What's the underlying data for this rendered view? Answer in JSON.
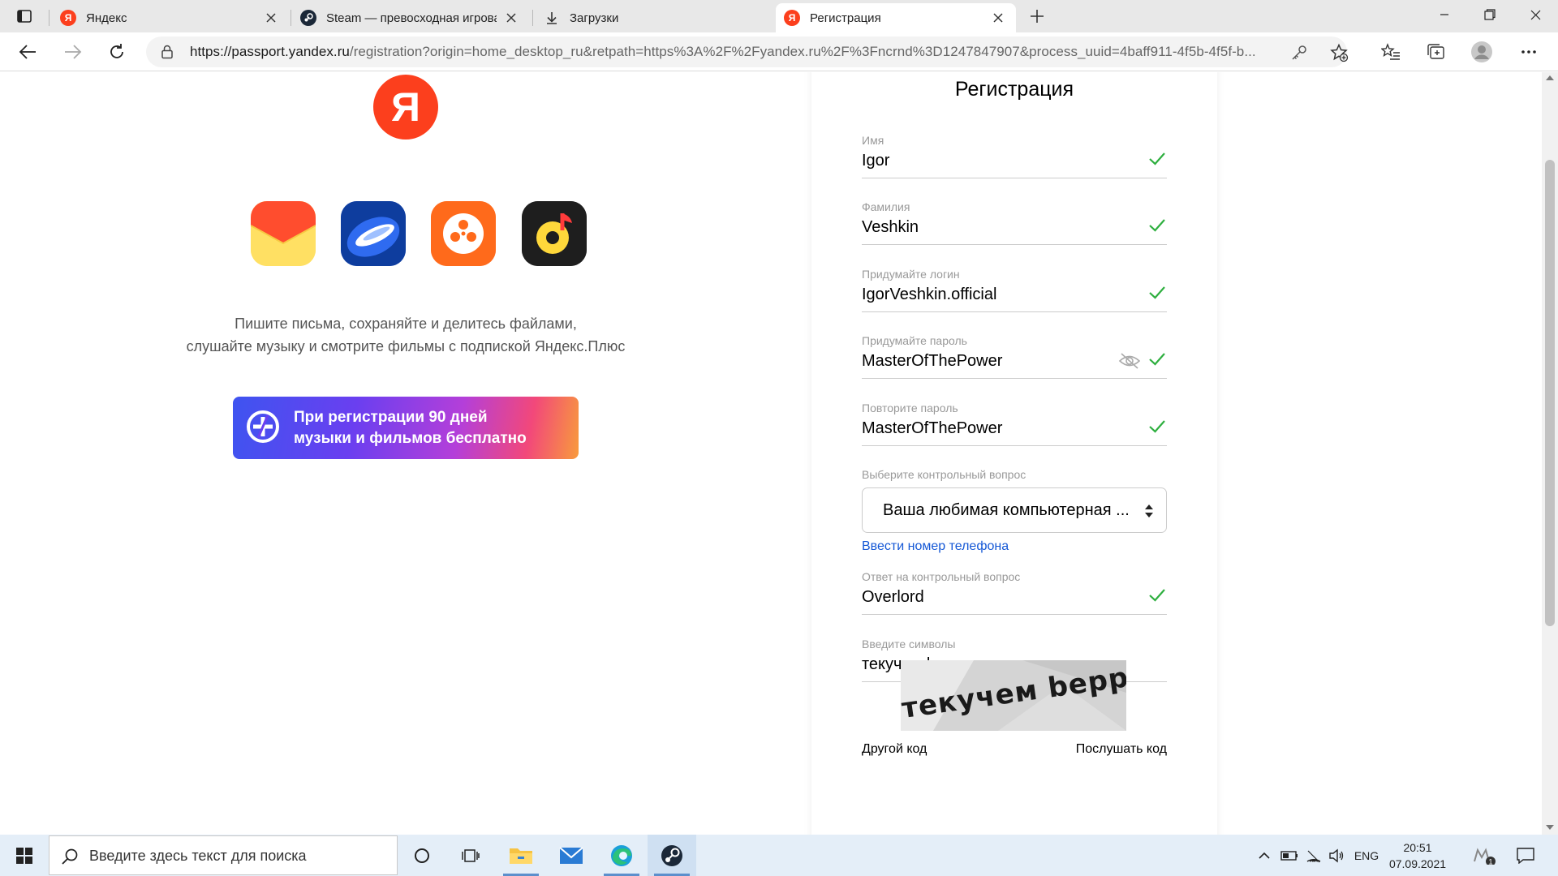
{
  "browser": {
    "tabs": [
      {
        "title": "Яндекс",
        "favicon": "yandex-icon",
        "active": false
      },
      {
        "title": "Steam — превосходная игровая платформа",
        "favicon": "steam-icon",
        "active": false
      },
      {
        "title": "Загрузки",
        "favicon": "download-icon",
        "active": false
      },
      {
        "title": "Регистрация",
        "favicon": "yandex-icon",
        "active": true
      }
    ],
    "url_host": "https://passport.yandex.ru",
    "url_rest": "/registration?origin=home_desktop_ru&retpath=https%3A%2F%2Fyandex.ru%2F%3Fncrnd%3D1247847907&process_uuid=4baff911-4f5b-4f5f-b..."
  },
  "page": {
    "logo_letter": "Я",
    "app_icons": [
      "mail-app-icon",
      "disk-app-icon",
      "kinopoisk-app-icon",
      "music-app-icon"
    ],
    "promo_line1": "Пишите письма, сохраняйте и делитесь файлами,",
    "promo_line2": "слушайте музыку и смотрите фильмы с подпиской Яндекс.Плюс",
    "plus_banner_line1": "При регистрации 90 дней",
    "plus_banner_line2": "музыки и фильмов бесплатно"
  },
  "form": {
    "title": "Регистрация",
    "fields": {
      "first_name": {
        "label": "Имя",
        "value": "Igor"
      },
      "last_name": {
        "label": "Фамилия",
        "value": "Veshkin"
      },
      "login": {
        "label": "Придумайте логин",
        "value": "IgorVeshkin.official"
      },
      "password": {
        "label": "Придумайте пароль",
        "value": "MasterOfThePower"
      },
      "password_repeat": {
        "label": "Повторите пароль",
        "value": "MasterOfThePower"
      },
      "security_answer": {
        "label": "Ответ на контрольный вопрос",
        "value": "Overlord"
      },
      "captcha_input": {
        "label": "Введите символы",
        "value": "текучем beppo"
      }
    },
    "security_question_label": "Выберите контрольный вопрос",
    "security_question_value": "Ваша любимая компьютерная ...",
    "phone_link": "Ввести номер телефона",
    "captcha_image_text": "текучем beppo",
    "other_code": "Другой код",
    "listen_code": "Послушать код",
    "valid_color": "#2eaf3f"
  },
  "taskbar": {
    "search_placeholder": "Введите здесь текст для поиска",
    "language": "ENG",
    "time": "20:51",
    "date": "07.09.2021",
    "notification_count": "1"
  }
}
